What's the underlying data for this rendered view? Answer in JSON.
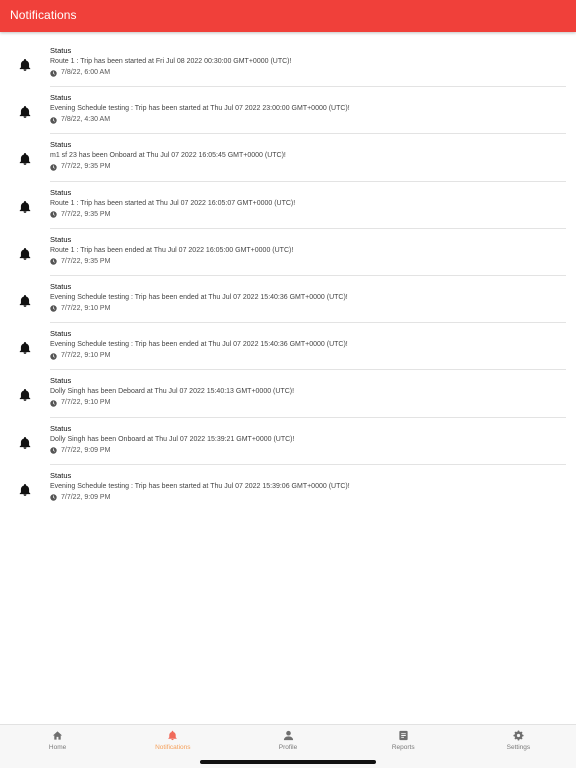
{
  "header": {
    "title": "Notifications"
  },
  "notifications": [
    {
      "title": "Status",
      "message": "Route 1 : Trip has been started at Fri Jul 08 2022 00:30:00 GMT+0000 (UTC)!",
      "time": "7/8/22, 6:00 AM"
    },
    {
      "title": "Status",
      "message": "Evening Schedule testing : Trip has been started at Thu Jul 07 2022 23:00:00 GMT+0000 (UTC)!",
      "time": "7/8/22, 4:30 AM"
    },
    {
      "title": "Status",
      "message": "m1 sf 23 has been Onboard at Thu Jul 07 2022 16:05:45 GMT+0000 (UTC)!",
      "time": "7/7/22, 9:35 PM"
    },
    {
      "title": "Status",
      "message": "Route 1 : Trip has been started at Thu Jul 07 2022 16:05:07 GMT+0000 (UTC)!",
      "time": "7/7/22, 9:35 PM"
    },
    {
      "title": "Status",
      "message": "Route 1 : Trip has been ended at Thu Jul 07 2022 16:05:00 GMT+0000 (UTC)!",
      "time": "7/7/22, 9:35 PM"
    },
    {
      "title": "Status",
      "message": "Evening Schedule testing : Trip has been ended at Thu Jul 07 2022 15:40:36 GMT+0000 (UTC)!",
      "time": "7/7/22, 9:10 PM"
    },
    {
      "title": "Status",
      "message": "Evening Schedule testing : Trip has been ended at Thu Jul 07 2022 15:40:36 GMT+0000 (UTC)!",
      "time": "7/7/22, 9:10 PM"
    },
    {
      "title": "Status",
      "message": "Dolly Singh has been Deboard at Thu Jul 07 2022 15:40:13 GMT+0000 (UTC)!",
      "time": "7/7/22, 9:10 PM"
    },
    {
      "title": "Status",
      "message": "Dolly Singh has been Onboard at Thu Jul 07 2022 15:39:21 GMT+0000 (UTC)!",
      "time": "7/7/22, 9:09 PM"
    },
    {
      "title": "Status",
      "message": "Evening Schedule testing : Trip has been started at Thu Jul 07 2022 15:39:06 GMT+0000 (UTC)!",
      "time": "7/7/22, 9:09 PM"
    }
  ],
  "tabbar": {
    "tabs": [
      {
        "label": "Home",
        "icon": "home-icon",
        "active": false
      },
      {
        "label": "Notifications",
        "icon": "bell-icon",
        "active": true
      },
      {
        "label": "Profile",
        "icon": "person-icon",
        "active": false
      },
      {
        "label": "Reports",
        "icon": "document-icon",
        "active": false
      },
      {
        "label": "Settings",
        "icon": "gear-icon",
        "active": false
      }
    ]
  },
  "colors": {
    "header_bg": "#f0403a",
    "active_tab": "#f5a05a",
    "inactive_tab": "#7a7a7a"
  }
}
